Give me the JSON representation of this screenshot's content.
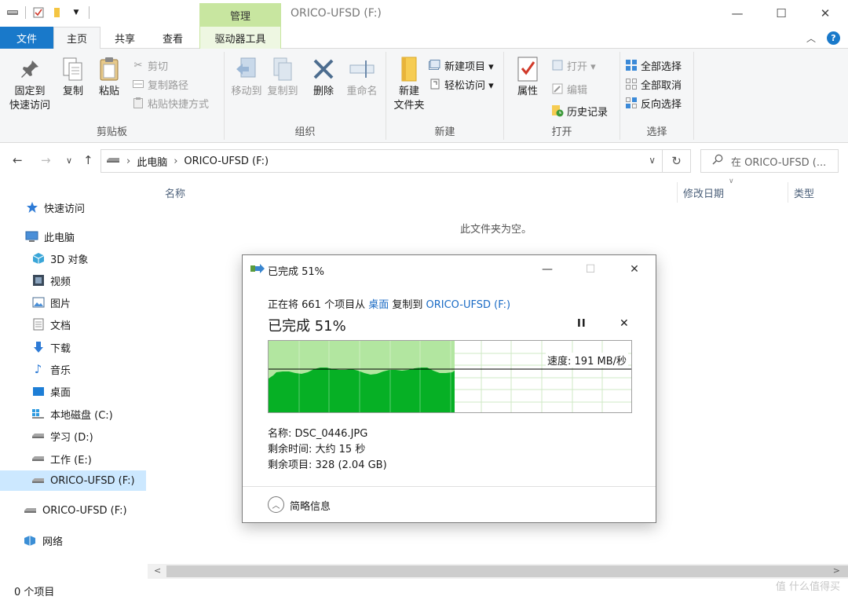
{
  "window": {
    "title": "ORICO-UFSD (F:)",
    "context_tab": "管理",
    "minimize": "—",
    "maximize": "☐",
    "close": "✕"
  },
  "ribbon_tabs": [
    "文件",
    "主页",
    "共享",
    "查看",
    "驱动器工具"
  ],
  "ribbon": {
    "clipboard": {
      "label": "剪贴板",
      "pin": "固定到\n快速访问",
      "copy": "复制",
      "paste": "粘贴",
      "cut": "剪切",
      "copy_path": "复制路径",
      "paste_shortcut": "粘贴快捷方式"
    },
    "organize": {
      "label": "组织",
      "move_to": "移动到",
      "copy_to": "复制到",
      "delete": "删除",
      "rename": "重命名"
    },
    "new": {
      "label": "新建",
      "new_folder": "新建\n文件夹",
      "new_item": "新建项目 ▾",
      "easy_access": "轻松访问 ▾"
    },
    "open": {
      "label": "打开",
      "properties": "属性",
      "open": "打开 ▾",
      "edit": "编辑",
      "history": "历史记录"
    },
    "select": {
      "label": "选择",
      "select_all": "全部选择",
      "select_none": "全部取消",
      "invert": "反向选择"
    }
  },
  "address": {
    "crumbs": [
      "此电脑",
      "ORICO-UFSD (F:)"
    ],
    "search_placeholder": "在 ORICO-UFSD (..."
  },
  "sidebar": {
    "items": [
      {
        "label": "快速访问",
        "icon": "star-icon"
      },
      {
        "label": "此电脑",
        "icon": "computer-icon"
      },
      {
        "label": "3D 对象",
        "icon": "cube-icon"
      },
      {
        "label": "视频",
        "icon": "film-icon"
      },
      {
        "label": "图片",
        "icon": "picture-icon"
      },
      {
        "label": "文档",
        "icon": "document-icon"
      },
      {
        "label": "下载",
        "icon": "download-icon"
      },
      {
        "label": "音乐",
        "icon": "music-icon"
      },
      {
        "label": "桌面",
        "icon": "desktop-icon"
      },
      {
        "label": "本地磁盘 (C:)",
        "icon": "windows-drive-icon"
      },
      {
        "label": "学习 (D:)",
        "icon": "drive-icon"
      },
      {
        "label": "工作 (E:)",
        "icon": "drive-icon"
      },
      {
        "label": "ORICO-UFSD (F:)",
        "icon": "drive-icon"
      },
      {
        "label": "ORICO-UFSD (F:)",
        "icon": "drive-icon"
      },
      {
        "label": "网络",
        "icon": "network-icon"
      }
    ]
  },
  "content": {
    "columns": [
      "名称",
      "修改日期",
      "类型"
    ],
    "empty_message": "此文件夹为空。"
  },
  "status": {
    "count": "0 个项目"
  },
  "watermark": "值 什么值得买",
  "dialog": {
    "title": "已完成 51%",
    "line_prefix": "正在将 661 个项目从 ",
    "source": "桌面",
    "line_middle": " 复制到 ",
    "destination": "ORICO-UFSD (F:)",
    "heading": "已完成 51%",
    "progress_percent": 51,
    "speed_label": "速度: 191 MB/秒",
    "name_line": "名称: DSC_0446.JPG",
    "time_line": "剩余时间: 大约 15 秒",
    "items_line": "剩余项目: 328 (2.04 GB)",
    "less_details": "简略信息",
    "pause": "II",
    "cancel": "✕"
  },
  "colors": {
    "accent": "#1979ca",
    "progress_fill": "#b2e6a0",
    "speed_fill": "#06b025"
  }
}
